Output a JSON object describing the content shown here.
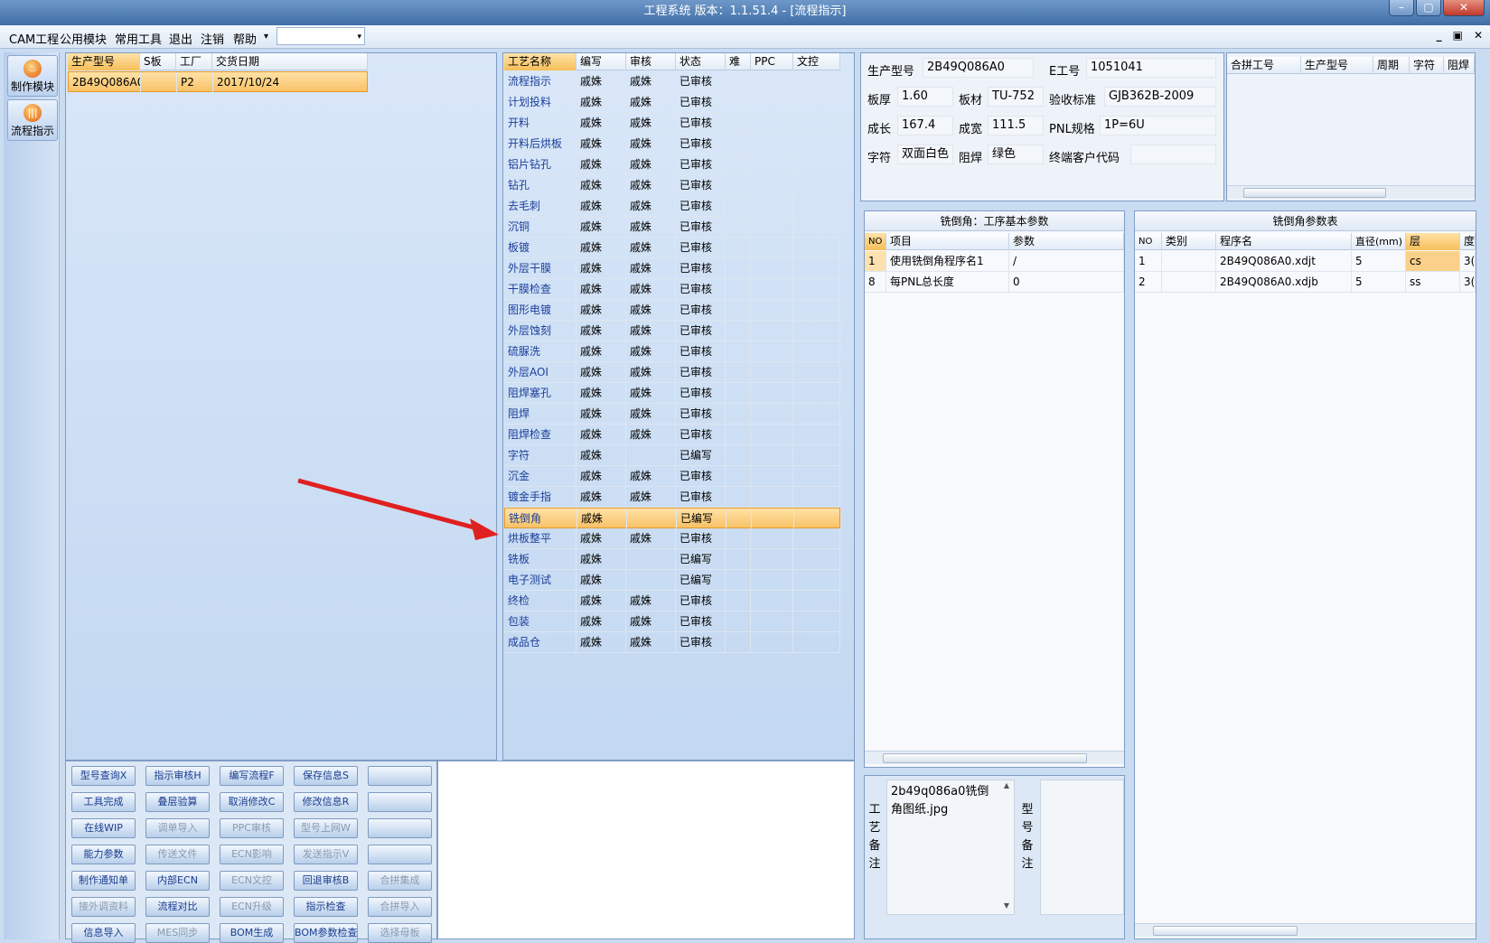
{
  "window": {
    "title": "工程系统  版本：1.1.51.4 - [流程指示]",
    "min": "–",
    "max": "▢",
    "close": "✕"
  },
  "menu": {
    "items": [
      "CAM工程",
      "公用模块",
      "常用工具",
      "退出",
      "注销",
      "帮助"
    ],
    "help_arrow": "▾",
    "combo_arrow": "▾",
    "mdi": [
      "_",
      "▣",
      "✕"
    ]
  },
  "leftbar": {
    "buttons": [
      {
        "label": "制作模块",
        "glyph": "♨"
      },
      {
        "label": "流程指示",
        "glyph": "|||"
      }
    ]
  },
  "models": {
    "headers": [
      "生产型号",
      "S板",
      "工厂",
      "交货日期"
    ],
    "rows": [
      [
        "2B49Q086A0",
        "",
        "P2",
        "2017/10/24"
      ]
    ]
  },
  "process": {
    "headers": [
      "工艺名称",
      "编写",
      "审核",
      "状态",
      "难",
      "PPC",
      "文控"
    ],
    "rows": [
      [
        "流程指示",
        "戚姝",
        "戚姝",
        "已审核"
      ],
      [
        "计划投料",
        "戚姝",
        "戚姝",
        "已审核"
      ],
      [
        "开料",
        "戚姝",
        "戚姝",
        "已审核"
      ],
      [
        "开料后烘板",
        "戚姝",
        "戚姝",
        "已审核"
      ],
      [
        "铝片钻孔",
        "戚姝",
        "戚姝",
        "已审核"
      ],
      [
        "钻孔",
        "戚姝",
        "戚姝",
        "已审核"
      ],
      [
        "去毛刺",
        "戚姝",
        "戚姝",
        "已审核"
      ],
      [
        "沉铜",
        "戚姝",
        "戚姝",
        "已审核"
      ],
      [
        "板镀",
        "戚姝",
        "戚姝",
        "已审核"
      ],
      [
        "外层干膜",
        "戚姝",
        "戚姝",
        "已审核"
      ],
      [
        "干膜检查",
        "戚姝",
        "戚姝",
        "已审核"
      ],
      [
        "图形电镀",
        "戚姝",
        "戚姝",
        "已审核"
      ],
      [
        "外层蚀刻",
        "戚姝",
        "戚姝",
        "已审核"
      ],
      [
        "硫脲洗",
        "戚姝",
        "戚姝",
        "已审核"
      ],
      [
        "外层AOI",
        "戚姝",
        "戚姝",
        "已审核"
      ],
      [
        "阻焊塞孔",
        "戚姝",
        "戚姝",
        "已审核"
      ],
      [
        "阻焊",
        "戚姝",
        "戚姝",
        "已审核"
      ],
      [
        "阻焊检查",
        "戚姝",
        "戚姝",
        "已审核"
      ],
      [
        "字符",
        "戚姝",
        "",
        "已编写"
      ],
      [
        "沉金",
        "戚姝",
        "戚姝",
        "已审核"
      ],
      [
        "镀金手指",
        "戚姝",
        "戚姝",
        "已审核"
      ],
      [
        "铣倒角",
        "戚姝",
        "",
        "已编写"
      ],
      [
        "烘板整平",
        "戚姝",
        "戚姝",
        "已审核"
      ],
      [
        "铣板",
        "戚姝",
        "",
        "已编写"
      ],
      [
        "电子测试",
        "戚姝",
        "",
        "已编写"
      ],
      [
        "终检",
        "戚姝",
        "戚姝",
        "已审核"
      ],
      [
        "包装",
        "戚姝",
        "戚姝",
        "已审核"
      ],
      [
        "成品仓",
        "戚姝",
        "戚姝",
        "已审核"
      ]
    ],
    "selected_index": 21
  },
  "info": {
    "model_label": "生产型号",
    "model": "2B49Q086A0",
    "eno_label": "E工号",
    "eno": "1051041",
    "thick_label": "板厚",
    "thick": "1.60",
    "mat_label": "板材",
    "mat": "TU-752",
    "std_label": "验收标准",
    "std": "GJB362B-2009",
    "len_label": "成长",
    "len": "167.4",
    "wid_label": "成宽",
    "wid": "111.5",
    "pnl_label": "PNL规格",
    "pnl": "1P=6U",
    "char_label": "字符",
    "char": "双面白色",
    "mask_label": "阻焊",
    "mask": "绿色",
    "cust_label": "终端客户代码",
    "cust": ""
  },
  "merge": {
    "headers": [
      "合拼工号",
      "生产型号",
      "周期",
      "字符",
      "阻焊"
    ]
  },
  "basic": {
    "title": "铣倒角：工序基本参数",
    "headers": [
      "NO",
      "项目",
      "参数"
    ],
    "rows": [
      [
        "1",
        "使用铣倒角程序名1",
        "/"
      ],
      [
        "8",
        "每PNL总长度",
        "0"
      ]
    ]
  },
  "params": {
    "title": "铣倒角参数表",
    "headers": [
      "NO",
      "类别",
      "程序名",
      "直径(mm)",
      "层",
      "度"
    ],
    "rows": [
      [
        "1",
        "",
        "2B49Q086A0.xdjt",
        "5",
        "cs",
        "3("
      ],
      [
        "2",
        "",
        "2B49Q086A0.xdjb",
        "5",
        "ss",
        "3("
      ]
    ]
  },
  "notes": {
    "craft_label": "工艺备注",
    "craft_text": "2b49q086a0铣倒角图纸.jpg",
    "model_label": "型号备注",
    "model_text": ""
  },
  "buttons": [
    [
      "型号查询X",
      "指示审核H",
      "编写流程F",
      "保存信息S",
      ""
    ],
    [
      "工具完成",
      "叠层验算",
      "取消修改C",
      "修改信息R",
      ""
    ],
    [
      "在线WIP",
      "调单导入",
      "PPC审核",
      "型号上网W",
      ""
    ],
    [
      "能力参数",
      "传送文件",
      "ECN影响",
      "发送指示V",
      ""
    ],
    [
      "制作通知单",
      "内部ECN",
      "ECN文控",
      "回退审核B",
      "合拼集成"
    ],
    [
      "接外调资料",
      "流程对比",
      "ECN升级",
      "指示检查",
      "合拼导入"
    ],
    [
      "信息导入",
      "MES同步",
      "BOM生成",
      "BOM参数检查",
      "选择母板"
    ]
  ],
  "buttons_disabled": [
    [
      false,
      false,
      false,
      false,
      false
    ],
    [
      false,
      false,
      false,
      false,
      false
    ],
    [
      false,
      true,
      true,
      true,
      false
    ],
    [
      false,
      true,
      true,
      true,
      false
    ],
    [
      false,
      false,
      true,
      false,
      true
    ],
    [
      true,
      false,
      true,
      false,
      true
    ],
    [
      false,
      true,
      false,
      false,
      true
    ]
  ],
  "colors": {
    "arrow": "#e02020",
    "selection": "#f8c267",
    "accent": "#3f6ea6"
  }
}
